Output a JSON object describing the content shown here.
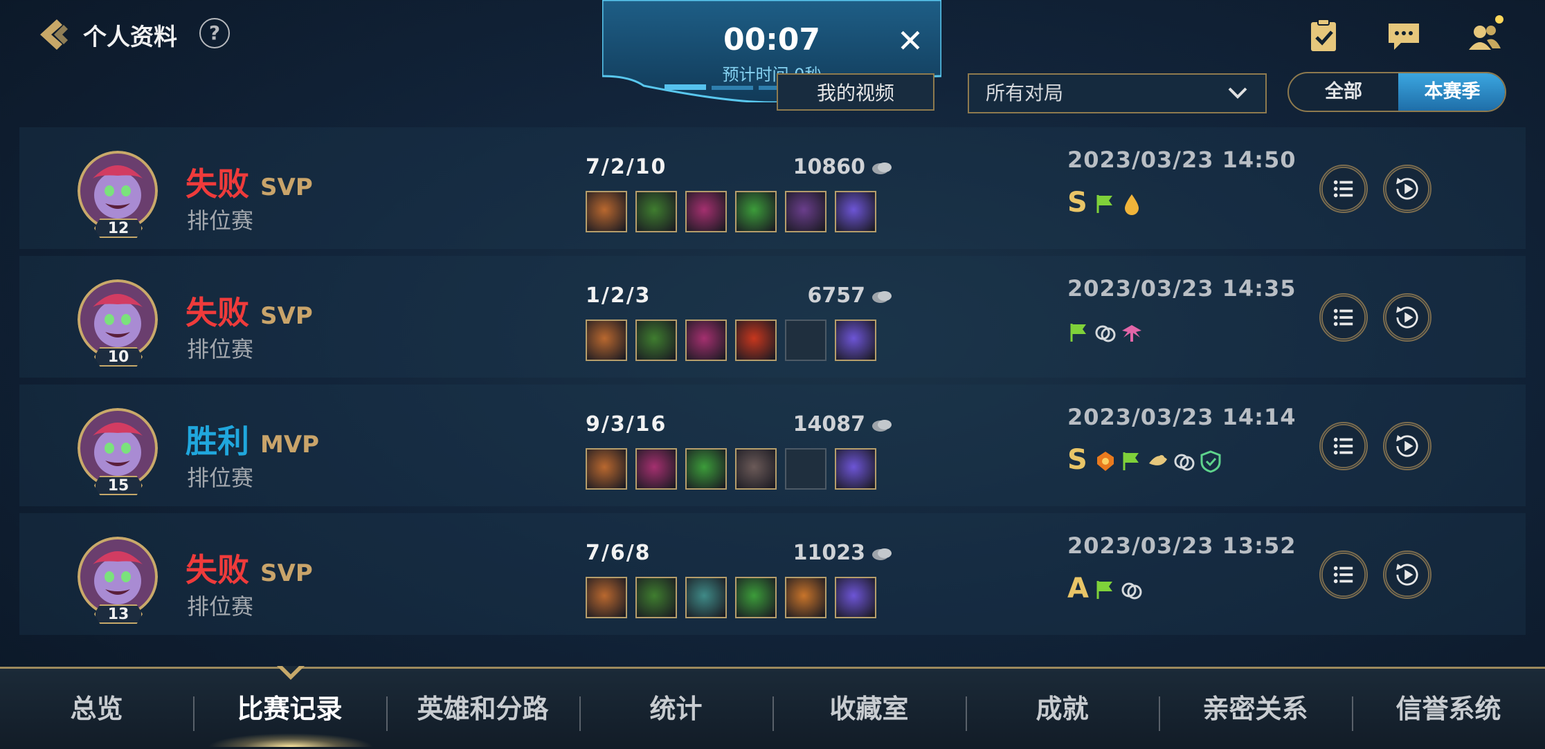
{
  "header": {
    "title": "个人资料",
    "help_label": "?"
  },
  "recording": {
    "time": "00:07",
    "estimate": "预计时间 0秒",
    "close_label": "✕"
  },
  "toolbar": {
    "my_video_label": "我的视频",
    "filter_value": "所有对局",
    "seg_all": "全部",
    "seg_season": "本赛季"
  },
  "matches": [
    {
      "result": "失败",
      "badge": "SVP",
      "mode": "排位赛",
      "level": "12",
      "kda": "7/2/10",
      "gold": "10860",
      "datetime": "2023/03/23 14:50",
      "grade": "S",
      "items": [
        "#b9682f",
        "#3f7d2f",
        "#a4306f",
        "#3c9c3a",
        "#6a3e8c",
        "#6d55d6"
      ],
      "honors": [
        "flag-icon",
        "droplet-icon"
      ]
    },
    {
      "result": "失败",
      "badge": "SVP",
      "mode": "排位赛",
      "level": "10",
      "kda": "1/2/3",
      "gold": "6757",
      "datetime": "2023/03/23 14:35",
      "grade": "",
      "items": [
        "#b9682f",
        "#3f7d2f",
        "#a4306f",
        "#c7371e",
        "#1f2f3e",
        "#6d55d6"
      ],
      "honors": [
        "flag-icon",
        "chain-icon",
        "wings-icon"
      ]
    },
    {
      "result": "胜利",
      "badge": "MVP",
      "mode": "排位赛",
      "level": "15",
      "kda": "9/3/16",
      "gold": "14087",
      "datetime": "2023/03/23 14:14",
      "grade": "S",
      "items": [
        "#b9682f",
        "#a4306f",
        "#3c9c3a",
        "#6b5a58",
        "#1f2f3e",
        "#6d55d6"
      ],
      "honors": [
        "crest-icon",
        "flag-icon",
        "scroll-icon",
        "chain-icon",
        "shield-icon"
      ]
    },
    {
      "result": "失败",
      "badge": "SVP",
      "mode": "排位赛",
      "level": "13",
      "kda": "7/6/8",
      "gold": "11023",
      "datetime": "2023/03/23 13:52",
      "grade": "A",
      "items": [
        "#b9682f",
        "#3f7d2f",
        "#3f8a87",
        "#3c9c3a",
        "#c8742a",
        "#6d55d6"
      ],
      "honors": [
        "flag-icon",
        "chain-icon"
      ]
    }
  ],
  "tabs": [
    "总览",
    "比赛记录",
    "英雄和分路",
    "统计",
    "收藏室",
    "成就",
    "亲密关系",
    "信誉系统"
  ],
  "active_tab": "比赛记录",
  "colors": {
    "accent_gold": "#c9a46a",
    "lose_red": "#ef3b3b",
    "win_blue": "#20a7dd"
  }
}
